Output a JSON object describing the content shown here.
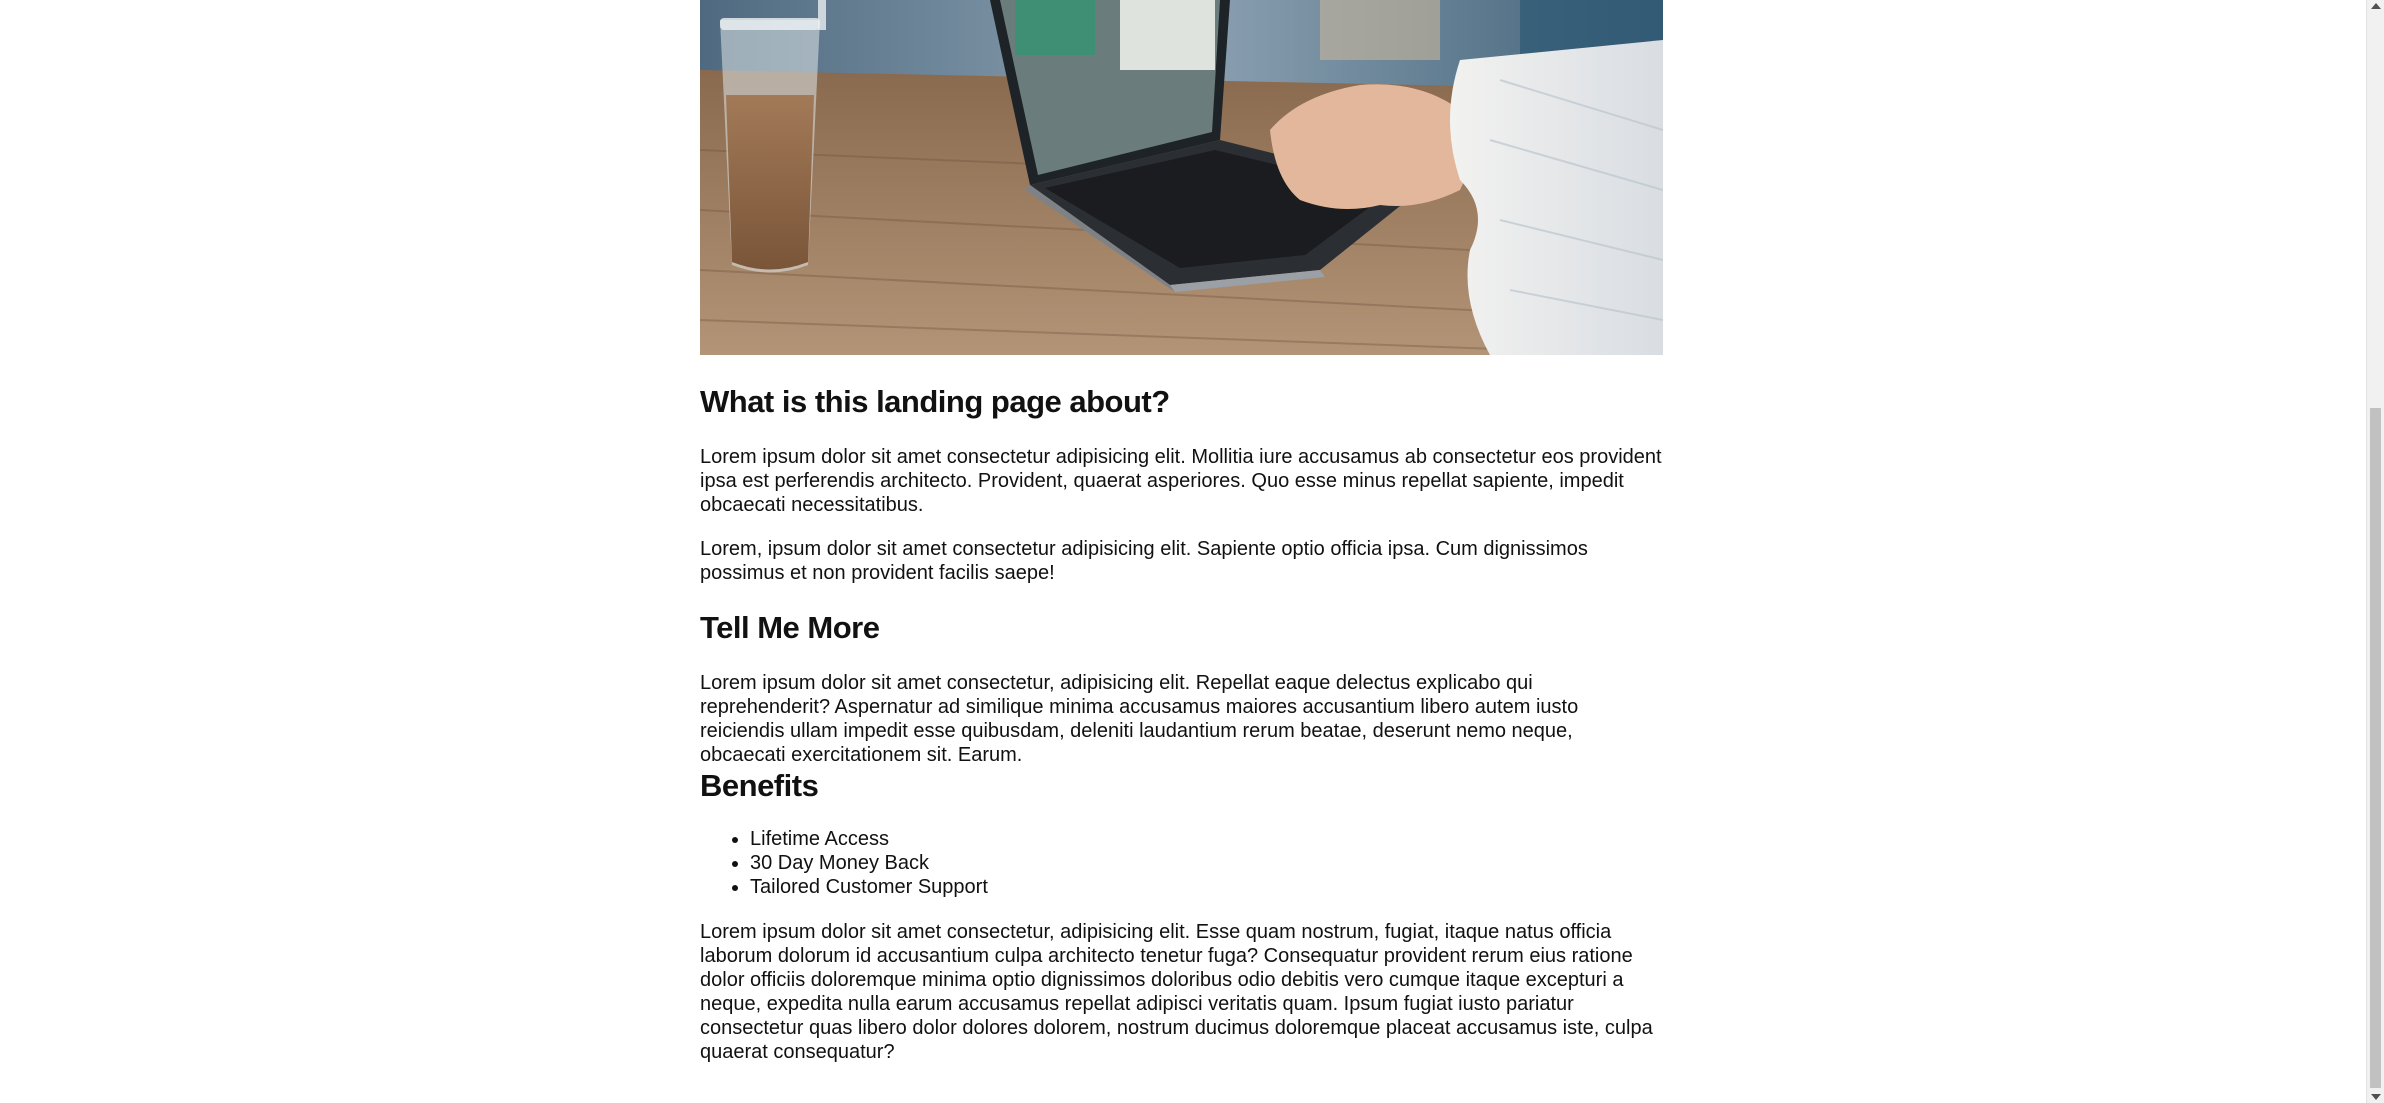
{
  "hero": {
    "image_description": "laptop-cafe-photo"
  },
  "sections": {
    "about": {
      "heading": "What is this landing page about?",
      "paragraph1": "Lorem ipsum dolor sit amet consectetur adipisicing elit. Mollitia iure accusamus ab consectetur eos provident ipsa est perferendis architecto. Provident, quaerat asperiores. Quo esse minus repellat sapiente, impedit obcaecati necessitatibus.",
      "paragraph2": "Lorem, ipsum dolor sit amet consectetur adipisicing elit. Sapiente optio officia ipsa. Cum dignissimos possimus et non provident facilis saepe!"
    },
    "tell_more": {
      "heading": "Tell Me More",
      "paragraph": "Lorem ipsum dolor sit amet consectetur, adipisicing elit. Repellat eaque delectus explicabo qui reprehenderit? Aspernatur ad similique minima accusamus maiores accusantium libero autem iusto reiciendis ullam impedit esse quibusdam, deleniti laudantium rerum beatae, deserunt nemo neque, obcaecati exercitationem sit. Earum."
    },
    "benefits": {
      "heading": "Benefits",
      "items": [
        "Lifetime Access",
        "30 Day Money Back",
        "Tailored Customer Support"
      ],
      "paragraph": "Lorem ipsum dolor sit amet consectetur, adipisicing elit. Esse quam nostrum, fugiat, itaque natus officia laborum dolorum id accusantium culpa architecto tenetur fuga? Consequatur provident rerum eius ratione dolor officiis doloremque minima optio dignissimos doloribus odio debitis vero cumque itaque excepturi a neque, expedita nulla earum accusamus repellat adipisci veritatis quam. Ipsum fugiat iusto pariatur consectetur quas libero dolor dolores dolorem, nostrum ducimus doloremque placeat accusamus iste, culpa quaerat consequatur?"
    }
  },
  "colors": {
    "text": "#111111",
    "background": "#ffffff",
    "scrollbar_track": "#f1f1f1",
    "scrollbar_thumb": "#c1c1c1"
  }
}
